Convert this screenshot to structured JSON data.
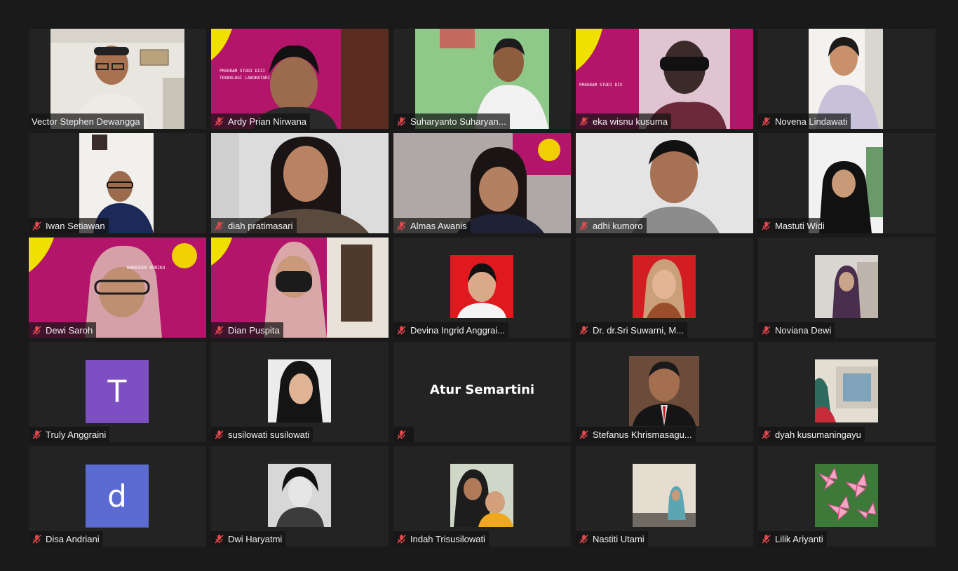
{
  "meeting": {
    "participants": [
      {
        "name": "Vector Stephen Dewangga",
        "muted": false
      },
      {
        "name": "Ardy Prian Nirwana",
        "muted": true
      },
      {
        "name": "Suharyanto Suharyan...",
        "muted": true
      },
      {
        "name": "eka wisnu kusuma",
        "muted": true
      },
      {
        "name": "Novena Lindawati",
        "muted": true
      },
      {
        "name": "Iwan Setiawan",
        "muted": true
      },
      {
        "name": "diah pratimasari",
        "muted": true
      },
      {
        "name": "Almas Awanis",
        "muted": true
      },
      {
        "name": "adhi kumoro",
        "muted": true
      },
      {
        "name": "Mastuti Widi",
        "muted": true
      },
      {
        "name": "Dewi Saroh",
        "muted": true
      },
      {
        "name": "Dian Puspita",
        "muted": true
      },
      {
        "name": "Devina Ingrid Anggrai...",
        "muted": true
      },
      {
        "name": "Dr. dr.Sri Suwarni, M...",
        "muted": true
      },
      {
        "name": "Noviana Dewi",
        "muted": true
      },
      {
        "name": "Truly Anggraini",
        "muted": true,
        "avatar_letter": "T",
        "avatar_color": "#7e4fc2"
      },
      {
        "name": "susilowati susilowati",
        "muted": true
      },
      {
        "name": "",
        "display_name": "Atur Semartini",
        "muted": true
      },
      {
        "name": "Stefanus Khrismasagu...",
        "muted": true
      },
      {
        "name": "dyah kusumaningayu",
        "muted": true
      },
      {
        "name": "Disa Andriani",
        "muted": true,
        "avatar_letter": "d",
        "avatar_color": "#5b6bd1"
      },
      {
        "name": "Dwi Haryatmi",
        "muted": true
      },
      {
        "name": "Indah Trisusilowati",
        "muted": true
      },
      {
        "name": "Nastiti Utami",
        "muted": true
      },
      {
        "name": "Lilik Ariyanti",
        "muted": true
      }
    ]
  },
  "colors": {
    "background": "#1a1a1a",
    "tile": "#232323",
    "muted_icon": "#e5484d",
    "banner_magenta": "#b3156b",
    "banner_yellow": "#f0e000"
  }
}
